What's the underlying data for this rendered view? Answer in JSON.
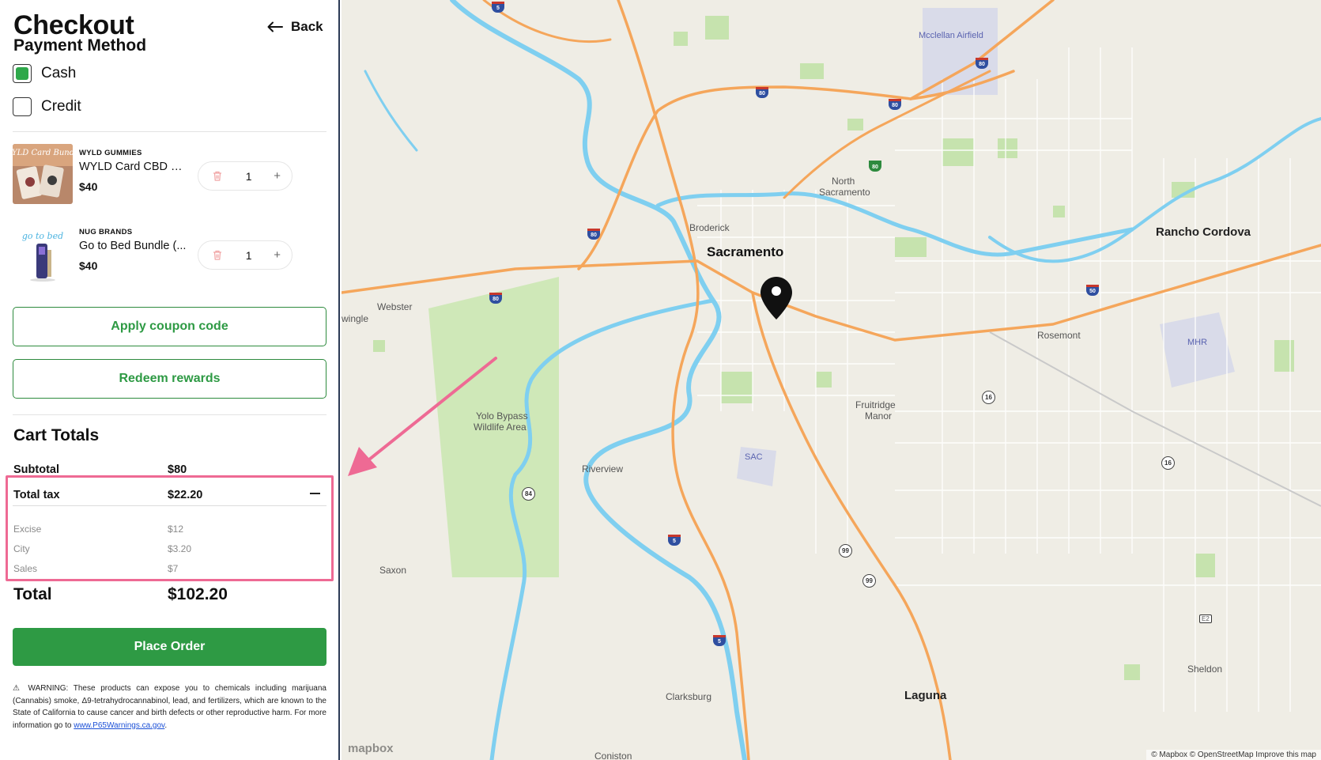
{
  "header": {
    "title": "Checkout",
    "subtitle": "Payment Method",
    "back_label": "Back"
  },
  "payment": {
    "options": [
      {
        "label": "Cash",
        "checked": true
      },
      {
        "label": "Credit",
        "checked": false
      }
    ]
  },
  "cart": {
    "items": [
      {
        "brand": "WYLD GUMMIES",
        "name": "WYLD Card CBD Gu...",
        "price": "$40",
        "quantity": "1",
        "thumb_text": "WYLD Card Bundle"
      },
      {
        "brand": "NUG BRANDS",
        "name": "Go to Bed Bundle (...",
        "price": "$40",
        "quantity": "1",
        "thumb_text": "go to bed"
      }
    ]
  },
  "actions": {
    "coupon_label": "Apply coupon code",
    "rewards_label": "Redeem rewards",
    "place_order_label": "Place Order"
  },
  "totals": {
    "title": "Cart Totals",
    "subtotal_label": "Subtotal",
    "subtotal_value": "$80",
    "tax_label": "Total tax",
    "tax_value": "$22.20",
    "tax_breakdown": [
      {
        "label": "Excise",
        "value": "$12"
      },
      {
        "label": "City",
        "value": "$3.20"
      },
      {
        "label": "Sales",
        "value": "$7"
      }
    ],
    "total_label": "Total",
    "total_value": "$102.20"
  },
  "warning": {
    "text": "⚠ WARNING: These products can expose you to chemicals including marijuana (Cannabis) smoke, Δ9-tetrahydrocannabinol, lead, and fertilizers, which are known to the State of California to cause cancer and birth defects or other reproductive harm. For more information go to ",
    "link_text": "www.P65Warnings.ca.gov",
    "link_suffix": "."
  },
  "map": {
    "labels": {
      "sacramento": "Sacramento",
      "rancho_cordova": "Rancho Cordova",
      "north_sacramento_1": "North",
      "north_sacramento_2": "Sacramento",
      "broderick": "Broderick",
      "webster": "Webster",
      "wingle": "wingle",
      "yolo_1": "Yolo Bypass",
      "yolo_2": "Wildlife Area",
      "riverview": "Riverview",
      "fruitridge_1": "Fruitridge",
      "fruitridge_2": "Manor",
      "rosemont": "Rosemont",
      "saxon": "Saxon",
      "clarksburg": "Clarksburg",
      "laguna": "Laguna",
      "sheldon": "Sheldon",
      "coniston": "Coniston",
      "mcclellan": "Mcclellan Airfield",
      "sac": "SAC",
      "mhr": "MHR"
    },
    "shields": {
      "i5": "5",
      "i80": "80",
      "us50": "50",
      "r16": "16",
      "r84": "84",
      "r99": "99",
      "e2": "E2"
    },
    "logo_text": "mapbox",
    "attribution": "© Mapbox © OpenStreetMap  Improve this map"
  },
  "colors": {
    "accent_green": "#2e9a44",
    "highlight_pink": "#ee6a94",
    "water": "#7fcff0",
    "highway": "#f5a65b"
  }
}
